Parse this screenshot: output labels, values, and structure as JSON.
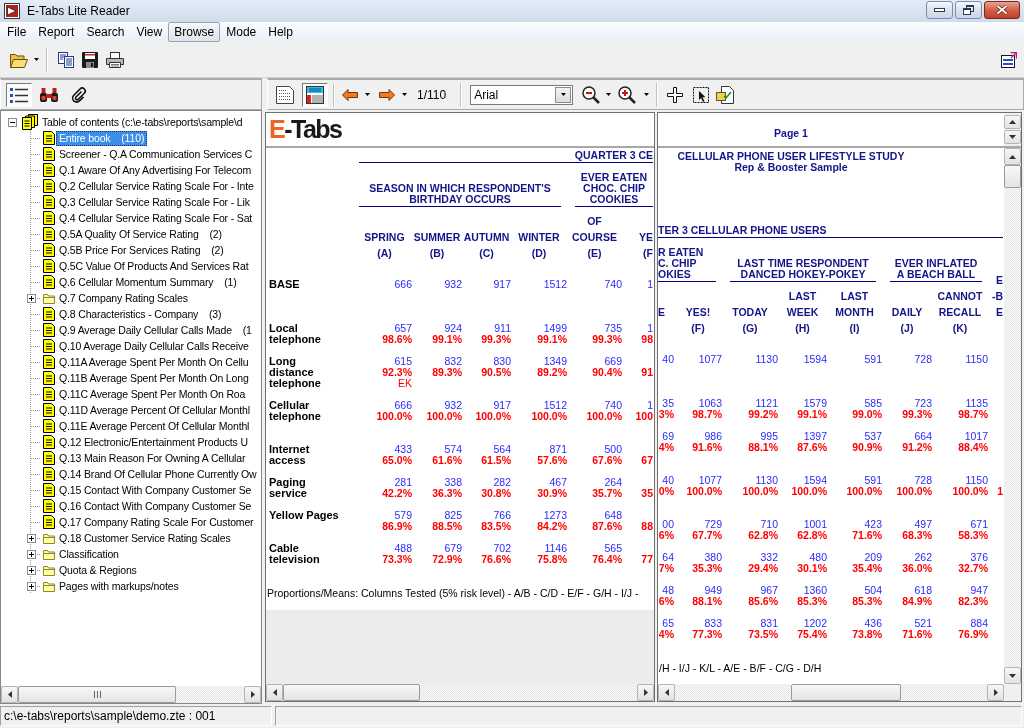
{
  "window": {
    "title": "E-Tabs Lite Reader"
  },
  "menu": [
    {
      "label": "File",
      "selected": false
    },
    {
      "label": "Report",
      "selected": false
    },
    {
      "label": "Search",
      "selected": false
    },
    {
      "label": "View",
      "selected": false
    },
    {
      "label": "Browse",
      "selected": true
    },
    {
      "label": "Mode",
      "selected": false
    },
    {
      "label": "Help",
      "selected": false
    }
  ],
  "contents_toolbar": [
    {
      "kind": "contents",
      "selected": true
    },
    {
      "kind": "find",
      "selected": false
    },
    {
      "kind": "attachments",
      "selected": false
    }
  ],
  "report_toolbar": {
    "views": [
      {
        "kind": "layout",
        "selected": false
      },
      {
        "kind": "table",
        "selected": true
      }
    ],
    "page": "1/110",
    "font": "Arial"
  },
  "toc": {
    "label": "Table of contents (c:\\e-tabs\\reports\\sample\\d",
    "expanded": true,
    "selected": false,
    "children": [
      {
        "kind": "page",
        "label": "Entire book",
        "count": "(110)",
        "selected": true
      },
      {
        "kind": "page",
        "label": "Screener - Q.A Communication Services C",
        "selected": false
      },
      {
        "kind": "page",
        "label": "Q.1 Aware Of Any Advertising For Telecom",
        "selected": false
      },
      {
        "kind": "page",
        "label": "Q.2 Cellular Service Rating Scale For - Inte",
        "selected": false
      },
      {
        "kind": "page",
        "label": "Q.3 Cellular Service Rating Scale For - Lik",
        "selected": false
      },
      {
        "kind": "page",
        "label": "Q.4 Cellular Service Rating Scale For - Sat",
        "selected": false
      },
      {
        "kind": "page",
        "label": "Q.5A Quality Of Service Rating",
        "count": "(2)",
        "selected": false
      },
      {
        "kind": "page",
        "label": "Q.5B Price For Services Rating",
        "count": "(2)",
        "selected": false
      },
      {
        "kind": "page",
        "label": "Q.5C Value Of Products And Services Rat",
        "selected": false
      },
      {
        "kind": "page",
        "label": "Q.6 Cellular Momentum Summary",
        "count": "(1)",
        "selected": false
      },
      {
        "kind": "folder",
        "label": "Q.7 Company Rating Scales",
        "expanded": false,
        "selected": false
      },
      {
        "kind": "page",
        "label": "Q.8 Characteristics - Company",
        "count": "(3)",
        "selected": false
      },
      {
        "kind": "page",
        "label": "Q.9 Average Daily Cellular Calls Made",
        "count": "(1",
        "selected": false
      },
      {
        "kind": "page",
        "label": "Q.10 Average Daily Cellular Calls Receive",
        "selected": false
      },
      {
        "kind": "page",
        "label": "Q.11A Average Spent Per Month On Cellu",
        "selected": false
      },
      {
        "kind": "page",
        "label": "Q.11B Average Spent Per Month On Long",
        "selected": false
      },
      {
        "kind": "page",
        "label": "Q.11C Average Spent Per Month On Roa",
        "selected": false
      },
      {
        "kind": "page",
        "label": "Q.11D Average Percent Of Cellular Monthl",
        "selected": false
      },
      {
        "kind": "page",
        "label": "Q.11E Average Percent Of Cellular Monthl",
        "selected": false
      },
      {
        "kind": "page",
        "label": "Q.12 Electronic/Entertainment Products U",
        "selected": false
      },
      {
        "kind": "page",
        "label": "Q.13 Main Reason For Owning A Cellular",
        "selected": false
      },
      {
        "kind": "page",
        "label": "Q.14 Brand Of Cellular Phone Currently Ow",
        "selected": false
      },
      {
        "kind": "page",
        "label": "Q.15 Contact With Company Customer Se",
        "selected": false
      },
      {
        "kind": "page",
        "label": "Q.16 Contact With Company Customer Se",
        "selected": false
      },
      {
        "kind": "page",
        "label": "Q.17 Company Rating Scale For Customer",
        "selected": false
      },
      {
        "kind": "folder",
        "label": "Q.18 Customer Service Rating Scales",
        "expanded": false,
        "selected": false
      },
      {
        "kind": "folder",
        "label": "Classification",
        "expanded": false,
        "selected": false
      },
      {
        "kind": "folder",
        "label": "Quota & Regions",
        "expanded": false,
        "selected": false
      },
      {
        "kind": "folder",
        "label": "Pages with markups/notes",
        "expanded": false,
        "selected": false
      }
    ]
  },
  "report_views": [
    {
      "header": {
        "kind": "logo",
        "lead": "E",
        "rest": "-Tabs"
      },
      "banner": "QUARTER 3 CE",
      "groups": [
        {
          "lines": [
            "SEASON IN WHICH RESPONDENT'S",
            "BIRTHDAY OCCURS"
          ],
          "columns": [
            {
              "lines": [
                "SPRING"
              ],
              "letter": "(A)"
            },
            {
              "lines": [
                "SUMMER"
              ],
              "letter": "(B)"
            },
            {
              "lines": [
                "AUTUMN"
              ],
              "letter": "(C)"
            },
            {
              "lines": [
                "WINTER"
              ],
              "letter": "(D)"
            }
          ]
        },
        {
          "lines": [
            "EVER EATEN",
            "CHOC. CHIP",
            "COOKIES"
          ],
          "columns": [
            {
              "lines": [
                "OF",
                "COURSE"
              ],
              "letter": "(E)"
            },
            {
              "lines": [
                "YE"
              ],
              "letter": "(F"
            }
          ]
        }
      ],
      "rows": [
        {
          "label": [
            "BASE"
          ],
          "cells": [
            {
              "count": "666"
            },
            {
              "count": "932"
            },
            {
              "count": "917"
            },
            {
              "count": "1512"
            },
            {
              "count": "740"
            },
            {
              "count": "1"
            }
          ]
        },
        {
          "label": [
            "Local",
            "telephone"
          ],
          "cells": [
            {
              "count": "657",
              "pct": "98.6%"
            },
            {
              "count": "924",
              "pct": "99.1%"
            },
            {
              "count": "911",
              "pct": "99.3%"
            },
            {
              "count": "1499",
              "pct": "99.1%"
            },
            {
              "count": "735",
              "pct": "99.3%"
            },
            {
              "count": "1",
              "pct": "98"
            }
          ]
        },
        {
          "label": [
            "Long",
            "distance",
            "telephone"
          ],
          "cells": [
            {
              "count": "615",
              "pct": "92.3%",
              "sig": "EK"
            },
            {
              "count": "832",
              "pct": "89.3%"
            },
            {
              "count": "830",
              "pct": "90.5%"
            },
            {
              "count": "1349",
              "pct": "89.2%"
            },
            {
              "count": "669",
              "pct": "90.4%"
            },
            {
              "pct": "91"
            }
          ]
        },
        {
          "label": [
            "Cellular",
            "telephone"
          ],
          "cells": [
            {
              "count": "666",
              "pct": "100.0%"
            },
            {
              "count": "932",
              "pct": "100.0%"
            },
            {
              "count": "917",
              "pct": "100.0%"
            },
            {
              "count": "1512",
              "pct": "100.0%"
            },
            {
              "count": "740",
              "pct": "100.0%"
            },
            {
              "count": "1",
              "pct": "100"
            }
          ]
        },
        {
          "label": [
            "Internet",
            "access"
          ],
          "cells": [
            {
              "count": "433",
              "pct": "65.0%"
            },
            {
              "count": "574",
              "pct": "61.6%"
            },
            {
              "count": "564",
              "pct": "61.5%"
            },
            {
              "count": "871",
              "pct": "57.6%"
            },
            {
              "count": "500",
              "pct": "67.6%"
            },
            {
              "pct": "67"
            }
          ]
        },
        {
          "label": [
            "Paging",
            "service"
          ],
          "cells": [
            {
              "count": "281",
              "pct": "42.2%"
            },
            {
              "count": "338",
              "pct": "36.3%"
            },
            {
              "count": "282",
              "pct": "30.8%"
            },
            {
              "count": "467",
              "pct": "30.9%"
            },
            {
              "count": "264",
              "pct": "35.7%"
            },
            {
              "pct": "35"
            }
          ]
        },
        {
          "label": [
            "Yellow Pages"
          ],
          "cells": [
            {
              "count": "579",
              "pct": "86.9%"
            },
            {
              "count": "825",
              "pct": "88.5%"
            },
            {
              "count": "766",
              "pct": "83.5%"
            },
            {
              "count": "1273",
              "pct": "84.2%"
            },
            {
              "count": "648",
              "pct": "87.6%"
            },
            {
              "pct": "88"
            }
          ]
        },
        {
          "label": [
            "Cable",
            "television"
          ],
          "cells": [
            {
              "count": "488",
              "pct": "73.3%"
            },
            {
              "count": "679",
              "pct": "72.9%"
            },
            {
              "count": "702",
              "pct": "76.6%"
            },
            {
              "count": "1146",
              "pct": "75.8%"
            },
            {
              "count": "565",
              "pct": "76.4%"
            },
            {
              "pct": "77"
            }
          ]
        }
      ],
      "footer": "Proportions/Means: Columns Tested (5% risk level) - A/B - C/D - E/F - G/H - I/J -"
    },
    {
      "header": {
        "kind": "page",
        "text": "Page 1"
      },
      "title": "CELLULAR PHONE USER LIFESTYLE STUDY",
      "subtitle": "Rep & Booster Sample",
      "banner": "TER 3 CELLULAR PHONE USERS",
      "groups": [
        {
          "lines": [
            "R EATEN",
            "C. CHIP",
            "OKIES"
          ],
          "columns": [
            {
              "lines": [
                "E"
              ]
            },
            {
              "lines": [
                "YES!"
              ],
              "letter": "(F)"
            }
          ]
        },
        {
          "lines": [
            "LAST TIME RESPONDENT",
            "DANCED HOKEY-POKEY"
          ],
          "columns": [
            {
              "lines": [
                "TODAY"
              ],
              "letter": "(G)"
            },
            {
              "lines": [
                "LAST",
                "WEEK"
              ],
              "letter": "(H)"
            },
            {
              "lines": [
                "LAST",
                "MONTH"
              ],
              "letter": "(I)"
            }
          ]
        },
        {
          "lines": [
            "EVER INFLATED",
            "A BEACH BALL"
          ],
          "columns": [
            {
              "lines": [
                "DAILY"
              ],
              "letter": "(J)"
            },
            {
              "lines": [
                "CANNOT",
                "RECALL"
              ],
              "letter": "(K)"
            }
          ]
        },
        {
          "columns": [
            {
              "lines": [
                "E",
                "-B",
                "E"
              ]
            }
          ]
        }
      ],
      "rows": [
        {
          "cells": [
            {
              "count": "40"
            },
            {
              "count": "1077"
            },
            {
              "count": "1130"
            },
            {
              "count": "1594"
            },
            {
              "count": "591"
            },
            {
              "count": "728"
            },
            {
              "count": "1150"
            }
          ]
        },
        {
          "cells": [
            {
              "count": "35",
              "pct": "3%"
            },
            {
              "count": "1063",
              "pct": "98.7%"
            },
            {
              "count": "1121",
              "pct": "99.2%"
            },
            {
              "count": "1579",
              "pct": "99.1%"
            },
            {
              "count": "585",
              "pct": "99.0%"
            },
            {
              "count": "723",
              "pct": "99.3%"
            },
            {
              "count": "1135",
              "pct": "98.7%"
            }
          ]
        },
        {
          "cells": [
            {
              "count": "69",
              "pct": "4%"
            },
            {
              "count": "986",
              "pct": "91.6%"
            },
            {
              "count": "995",
              "pct": "88.1%"
            },
            {
              "count": "1397",
              "pct": "87.6%"
            },
            {
              "count": "537",
              "pct": "90.9%"
            },
            {
              "count": "664",
              "pct": "91.2%"
            },
            {
              "count": "1017",
              "pct": "88.4%"
            }
          ]
        },
        {
          "cells": [
            {
              "count": "40",
              "pct": "0%"
            },
            {
              "count": "1077",
              "pct": "100.0%"
            },
            {
              "count": "1130",
              "pct": "100.0%"
            },
            {
              "count": "1594",
              "pct": "100.0%"
            },
            {
              "count": "591",
              "pct": "100.0%"
            },
            {
              "count": "728",
              "pct": "100.0%"
            },
            {
              "count": "1150",
              "pct": "100.0%"
            },
            {
              "pct": "1"
            }
          ]
        },
        {
          "cells": [
            {
              "count": "00",
              "pct": "6%"
            },
            {
              "count": "729",
              "pct": "67.7%"
            },
            {
              "count": "710",
              "pct": "62.8%"
            },
            {
              "count": "1001",
              "pct": "62.8%"
            },
            {
              "count": "423",
              "pct": "71.6%"
            },
            {
              "count": "497",
              "pct": "68.3%"
            },
            {
              "count": "671",
              "pct": "58.3%"
            }
          ]
        },
        {
          "cells": [
            {
              "count": "64",
              "pct": "7%"
            },
            {
              "count": "380",
              "pct": "35.3%"
            },
            {
              "count": "332",
              "pct": "29.4%"
            },
            {
              "count": "480",
              "pct": "30.1%"
            },
            {
              "count": "209",
              "pct": "35.4%"
            },
            {
              "count": "262",
              "pct": "36.0%"
            },
            {
              "count": "376",
              "pct": "32.7%"
            }
          ]
        },
        {
          "cells": [
            {
              "count": "48",
              "pct": "6%"
            },
            {
              "count": "949",
              "pct": "88.1%"
            },
            {
              "count": "967",
              "pct": "85.6%"
            },
            {
              "count": "1360",
              "pct": "85.3%"
            },
            {
              "count": "504",
              "pct": "85.3%"
            },
            {
              "count": "618",
              "pct": "84.9%"
            },
            {
              "count": "947",
              "pct": "82.3%"
            }
          ]
        },
        {
          "cells": [
            {
              "count": "65",
              "pct": "4%"
            },
            {
              "count": "833",
              "pct": "77.3%"
            },
            {
              "count": "831",
              "pct": "73.5%"
            },
            {
              "count": "1202",
              "pct": "75.4%"
            },
            {
              "count": "436",
              "pct": "73.8%"
            },
            {
              "count": "521",
              "pct": "71.6%"
            },
            {
              "count": "884",
              "pct": "76.9%"
            }
          ]
        }
      ],
      "footer": "/H - I/J - K/L - A/E - B/F - C/G - D/H"
    }
  ],
  "status_bar": {
    "path": "c:\\e-tabs\\reports\\sample\\demo.zte : 001"
  }
}
